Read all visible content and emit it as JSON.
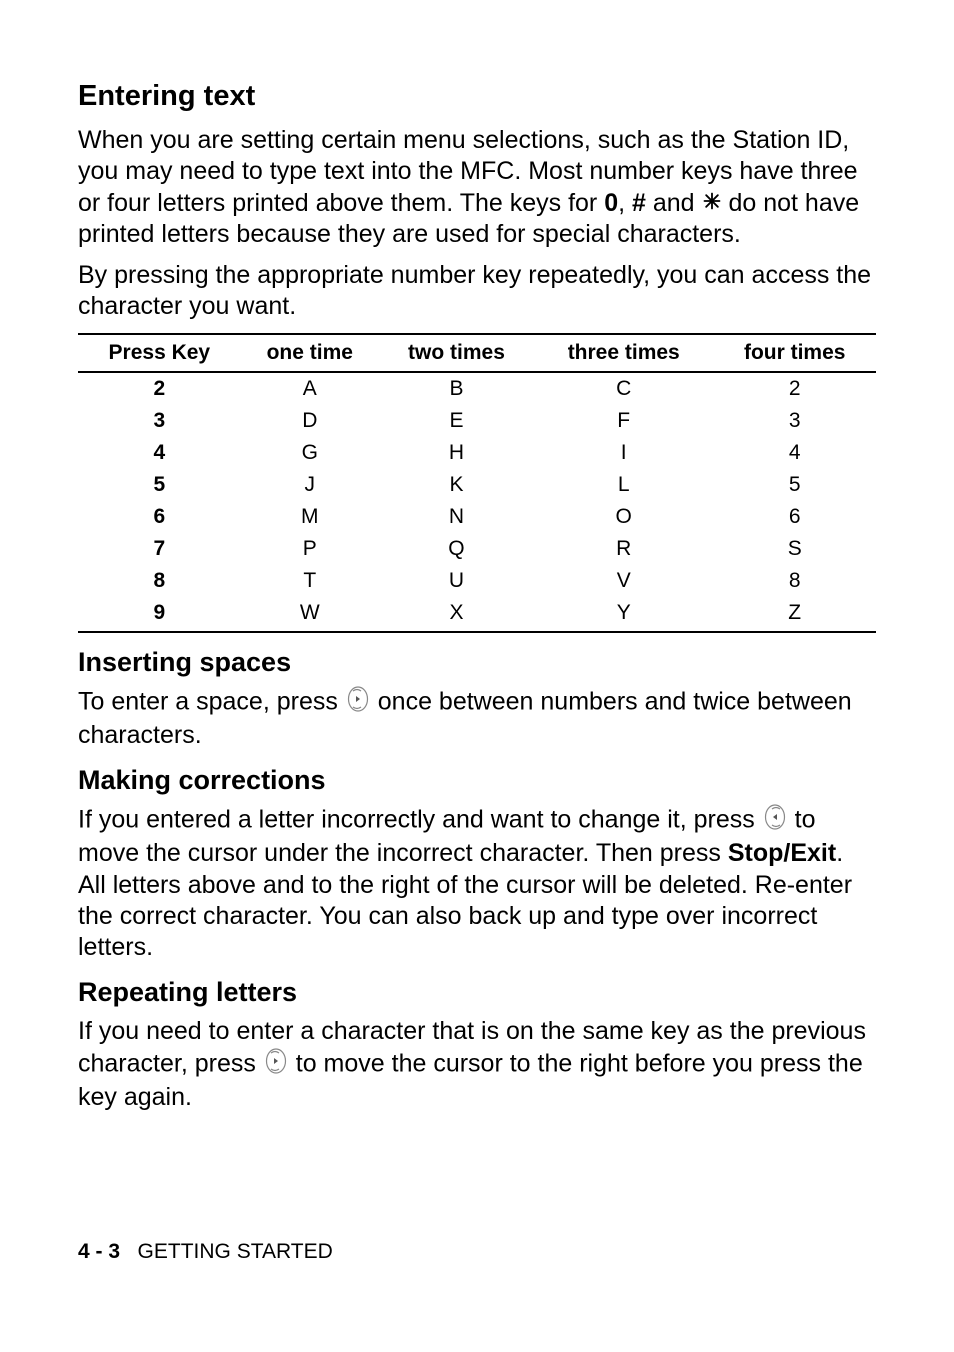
{
  "section1": {
    "title": "Entering text",
    "para1_a": "When you are setting certain menu selections, such as the Station ID, you may need to type text into the MFC. Most number keys have three or four letters printed above them. The keys for ",
    "key0": "0",
    "comma": ", ",
    "keyhash": "#",
    "and": " and ",
    "para1_b": " do not have printed letters because they are used for special characters.",
    "para2": "By pressing the appropriate number key repeatedly, you can access the character you want."
  },
  "table": {
    "headers": [
      "Press Key",
      "one time",
      "two times",
      "three times",
      "four times"
    ],
    "rows": [
      [
        "2",
        "A",
        "B",
        "C",
        "2"
      ],
      [
        "3",
        "D",
        "E",
        "F",
        "3"
      ],
      [
        "4",
        "G",
        "H",
        "I",
        "4"
      ],
      [
        "5",
        "J",
        "K",
        "L",
        "5"
      ],
      [
        "6",
        "M",
        "N",
        "O",
        "6"
      ],
      [
        "7",
        "P",
        "Q",
        "R",
        "S"
      ],
      [
        "8",
        "T",
        "U",
        "V",
        "8"
      ],
      [
        "9",
        "W",
        "X",
        "Y",
        "Z"
      ]
    ]
  },
  "section2": {
    "title": "Inserting spaces",
    "para_a": "To enter a space, press ",
    "para_b": " once between numbers and twice between characters."
  },
  "section3": {
    "title": "Making corrections",
    "para_a": "If you entered a letter incorrectly and want to change it, press ",
    "para_b": " to move the cursor under the incorrect character. Then press ",
    "stopexit": "Stop/Exit",
    "para_c": ". All letters above and to the right of the cursor will be deleted. Re-enter the correct character. You can also back up and type over incorrect letters."
  },
  "section4": {
    "title": "Repeating letters",
    "para_a": "If you need to enter a character that is on the same key as the previous character, press ",
    "para_b": " to move the cursor to the right before you press the key again."
  },
  "footer": {
    "page": "4 - 3",
    "label": "GETTING STARTED"
  }
}
